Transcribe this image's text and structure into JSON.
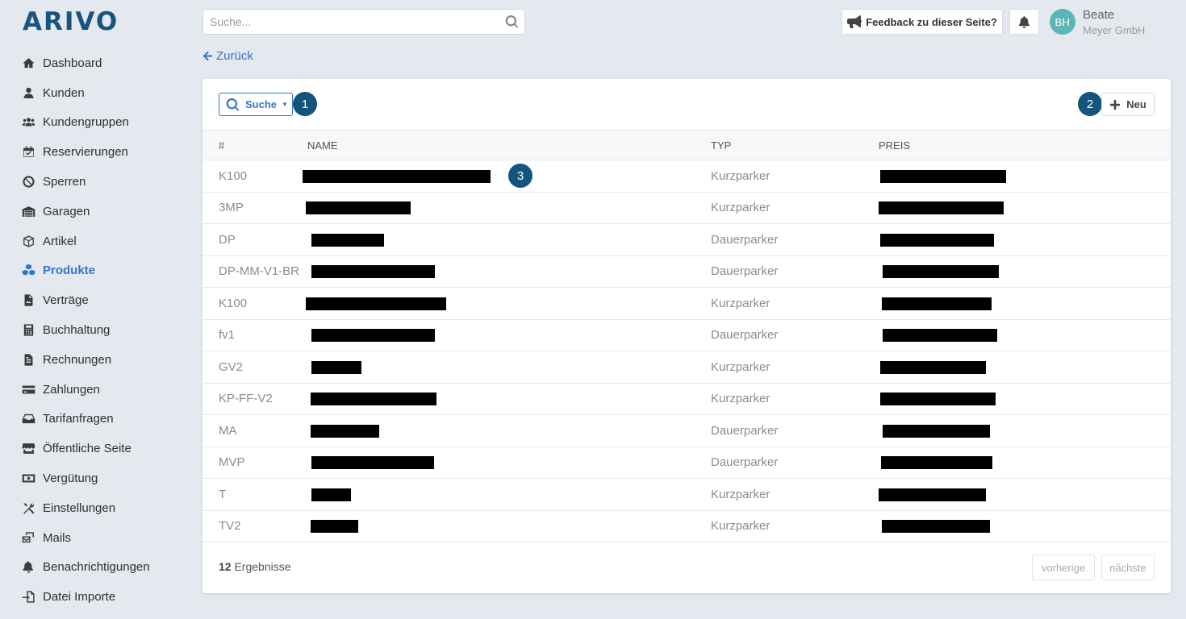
{
  "app": {
    "logo": "ARIVO"
  },
  "sidebar": {
    "items": [
      {
        "label": "Dashboard",
        "icon": "home-icon"
      },
      {
        "label": "Kunden",
        "icon": "user-icon"
      },
      {
        "label": "Kundengruppen",
        "icon": "users-icon"
      },
      {
        "label": "Reservierungen",
        "icon": "calendar-check-icon"
      },
      {
        "label": "Sperren",
        "icon": "ban-icon"
      },
      {
        "label": "Garagen",
        "icon": "warehouse-icon"
      },
      {
        "label": "Artikel",
        "icon": "box-icon"
      },
      {
        "label": "Produkte",
        "icon": "cubes-icon",
        "active": true
      },
      {
        "label": "Verträge",
        "icon": "file-contract-icon"
      },
      {
        "label": "Buchhaltung",
        "icon": "calculator-icon"
      },
      {
        "label": "Rechnungen",
        "icon": "file-invoice-icon"
      },
      {
        "label": "Zahlungen",
        "icon": "credit-card-icon"
      },
      {
        "label": "Tarifanfragen",
        "icon": "inbox-icon"
      },
      {
        "label": "Öffentliche Seite",
        "icon": "store-icon"
      },
      {
        "label": "Vergütung",
        "icon": "money-bill-icon"
      },
      {
        "label": "Einstellungen",
        "icon": "tools-icon"
      },
      {
        "label": "Mails",
        "icon": "mail-bulk-icon"
      },
      {
        "label": "Benachrichtigungen",
        "icon": "bell-icon"
      },
      {
        "label": "Datei Importe",
        "icon": "file-import-icon"
      }
    ]
  },
  "header": {
    "search_placeholder": "Suche...",
    "feedback_label": "Feedback zu dieser Seite?",
    "user": {
      "initials": "BH",
      "name": "Beate",
      "company": "Meyer GmbH"
    }
  },
  "back_label": "Zurück",
  "toolbar": {
    "search_label": "Suche",
    "new_label": "Neu"
  },
  "markers": [
    "1",
    "2",
    "3"
  ],
  "table": {
    "columns": [
      "#",
      "NAME",
      "TYP",
      "PREIS"
    ],
    "rows": [
      {
        "id": "K100",
        "typ": "Kurzparker"
      },
      {
        "id": "3MP",
        "typ": "Kurzparker"
      },
      {
        "id": "DP",
        "typ": "Dauerparker"
      },
      {
        "id": "DP-MM-V1-BR",
        "typ": "Dauerparker"
      },
      {
        "id": "K100",
        "typ": "Kurzparker"
      },
      {
        "id": "fv1",
        "typ": "Dauerparker"
      },
      {
        "id": "GV2",
        "typ": "Kurzparker"
      },
      {
        "id": "KP-FF-V2",
        "typ": "Kurzparker"
      },
      {
        "id": "MA",
        "typ": "Dauerparker"
      },
      {
        "id": "MVP",
        "typ": "Dauerparker"
      },
      {
        "id": "T",
        "typ": "Kurzparker"
      },
      {
        "id": "TV2",
        "typ": "Kurzparker"
      }
    ]
  },
  "footer": {
    "result_count": "12",
    "result_label": "Ergebnisse",
    "prev_label": "vorherige",
    "next_label": "nächste"
  }
}
